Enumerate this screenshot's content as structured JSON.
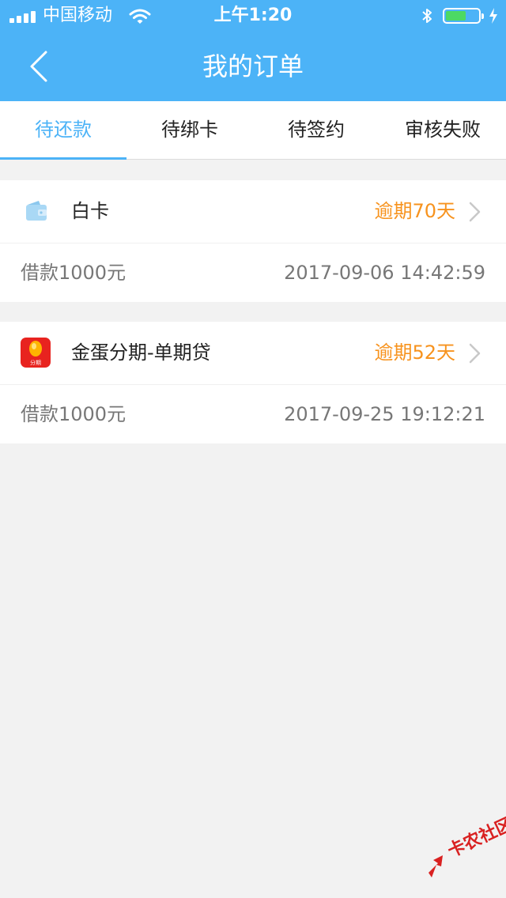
{
  "status_bar": {
    "carrier": "中国移动",
    "time": "上午1:20",
    "battery_color": "#4cd964"
  },
  "nav": {
    "title": "我的订单",
    "back_icon": "chevron-left-icon"
  },
  "tabs": [
    {
      "label": "待还款",
      "active": true
    },
    {
      "label": "待绑卡",
      "active": false
    },
    {
      "label": "待签约",
      "active": false
    },
    {
      "label": "审核失败",
      "active": false
    }
  ],
  "orders": [
    {
      "icon": "wallet-icon",
      "name": "白卡",
      "status": "逾期70天",
      "amount": "借款1000元",
      "time": "2017-09-06 14:42:59"
    },
    {
      "icon": "jindan-app-icon",
      "icon_text": "分期",
      "name": "金蛋分期-单期贷",
      "status": "逾期52天",
      "amount": "借款1000元",
      "time": "2017-09-25 19:12:21"
    }
  ],
  "watermark": {
    "text": "卡农社区"
  },
  "colors": {
    "primary": "#4cb3f7",
    "overdue": "#f7931e",
    "background": "#f2f2f2"
  }
}
